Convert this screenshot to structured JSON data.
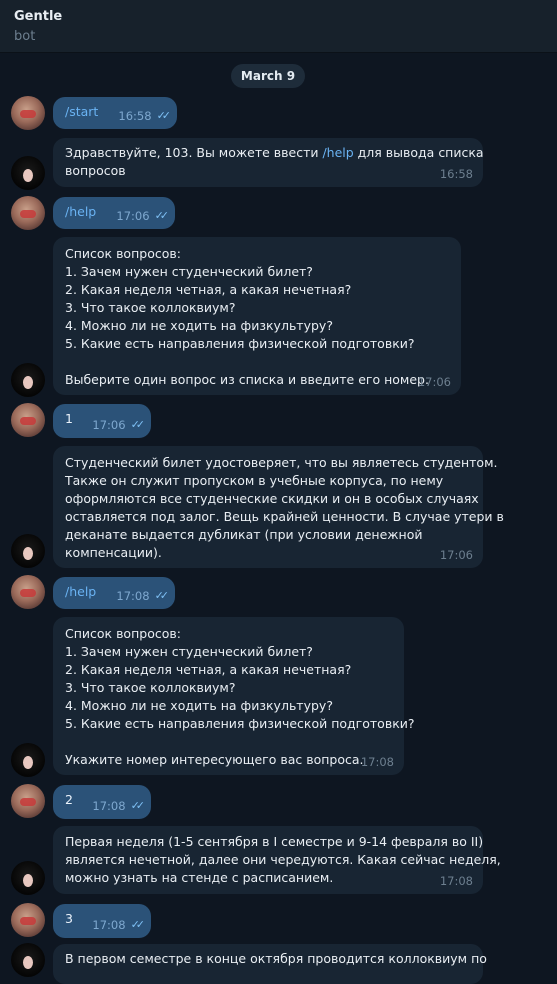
{
  "header": {
    "title": "Gentle",
    "subtitle": "bot"
  },
  "date_separator": "March 9",
  "messages": [
    {
      "text": "/start",
      "time": "16:58"
    },
    {
      "text_a": "Здравствуйте, 103. Вы можете ввести ",
      "cmd": "/help",
      "text_b": " для вывода списка",
      "text_c": "вопросов",
      "time": "16:58"
    },
    {
      "text": "/help",
      "time": "17:06"
    },
    {
      "lines": [
        "Список вопросов:",
        "1. Зачем нужен студенческий билет?",
        "2. Какая неделя четная, а какая нечетная?",
        "3. Что такое коллоквиум?",
        "4. Можно ли не ходить на физкультуру?",
        "5. Какие есть направления физической подготовки?"
      ],
      "last": "Выберите один вопрос из списка и введите его номер.",
      "time": "17:06"
    },
    {
      "text": "1",
      "time": "17:06"
    },
    {
      "lines": [
        "Студенческий билет удостоверяет, что вы являетесь студентом.",
        "Также он служит пропуском в учебные корпуса, по нему",
        "оформляются все студенческие скидки и он в особых случаях",
        "оставляется под залог. Вещь крайней ценности. В случае утери в",
        "деканате выдается дубликат (при условии денежной",
        "компенсации)."
      ],
      "time": "17:06"
    },
    {
      "text": "/help",
      "time": "17:08"
    },
    {
      "lines": [
        "Список вопросов:",
        "1. Зачем нужен студенческий билет?",
        "2. Какая неделя четная, а какая нечетная?",
        "3. Что такое коллоквиум?",
        "4. Можно ли не ходить на физкультуру?",
        "5. Какие есть направления физической подготовки?"
      ],
      "last": "Укажите номер интересующего вас вопроса.",
      "time": "17:08"
    },
    {
      "text": "2",
      "time": "17:08"
    },
    {
      "lines": [
        "Первая неделя (1-5 сентября в I семестре и 9-14 февраля во II)",
        "является нечетной, далее они чередуются. Какая сейчас неделя,",
        "можно узнать на стенде с расписанием."
      ],
      "time": "17:08"
    },
    {
      "text": "3",
      "time": "17:08"
    },
    {
      "lines": [
        "В первом семестре в конце октября проводится коллоквиум по"
      ]
    }
  ],
  "icons": {
    "read": "double-check-icon",
    "user_avatar": "user-avatar",
    "bot_avatar": "bot-avatar"
  },
  "colors": {
    "background": "#0e1621",
    "outgoing": "#2b5278",
    "incoming": "#182533",
    "link": "#6ab3f3"
  }
}
